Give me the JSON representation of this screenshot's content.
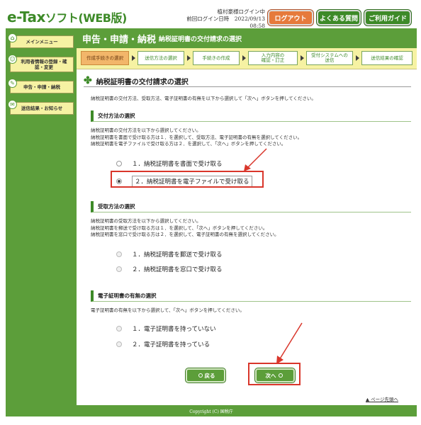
{
  "header": {
    "logo_main": "e-Tax",
    "logo_sub": "ソフト(WEB版)",
    "login_user": "植村豪様ログイン中",
    "last_login": "前回ログイン日時　2022/09/13 08:58",
    "logout_label": "ログアウト",
    "faq_label": "よくある質問",
    "guide_label": "ご利用ガイド"
  },
  "sidebar": {
    "items": [
      {
        "label": "メインメニュー",
        "icon": "home-icon"
      },
      {
        "label": "利用者情報の登録・確認・変更",
        "icon": "user-icon"
      },
      {
        "label": "申告・申請・納税",
        "icon": "document-icon"
      },
      {
        "label": "送信結果・お知らせ",
        "icon": "mail-icon"
      }
    ]
  },
  "main": {
    "title_big": "申告・申請・納税",
    "title_small": "納税証明書の交付請求の選択",
    "steps": [
      {
        "label": "作成手続きの選択",
        "active": true
      },
      {
        "label": "送信方法の選択",
        "active": false
      },
      {
        "label": "手続きの作成",
        "active": false
      },
      {
        "label": "入力内容の\n確認・訂正",
        "active": false
      },
      {
        "label": "受付システムへの\n送信",
        "active": false
      },
      {
        "label": "送信結果の確認",
        "active": false
      }
    ],
    "section_title": "納税証明書の交付請求の選択",
    "intro": "納税証明書の交付方法、受取方法、電子証明書の有無を以下から選択して「次へ」ボタンを押してください。",
    "delivery": {
      "heading": "交付方法の選択",
      "desc1": "納税証明書の交付方法を以下から選択してください。",
      "desc2": "納税証明書を書面で受け取る方は１．を選択して、受取方法、電子証明書の有無を選択してください。",
      "desc3": "納税証明書を電子ファイルで受け取る方は２．を選択して、「次へ」ボタンを押してください。",
      "options": [
        "１．納税証明書を書面で受け取る",
        "２．納税証明書を電子ファイルで受け取る"
      ],
      "selected_index": 1
    },
    "receive": {
      "heading": "受取方法の選択",
      "desc1": "納税証明書の受取方法を以下から選択してください。",
      "desc2": "納税証明書を郵送で受け取る方は１．を選択して、「次へ」ボタンを押してください。",
      "desc3": "納税証明書を窓口で受け取る方は２．を選択して、電子証明書の有無を選択してください。",
      "options": [
        "１．納税証明書を郵送で受け取る",
        "２．納税証明書を窓口で受け取る"
      ]
    },
    "cert": {
      "heading": "電子証明書の有無の選択",
      "desc1": "電子証明書の有無を以下から選択して、「次へ」ボタンを押してください。",
      "options": [
        "１．電子証明書を持っていない",
        "２．電子証明書を持っている"
      ]
    },
    "back_label": "戻る",
    "next_label": "次へ",
    "page_top": "ページ先頭へ",
    "copyright": "Copyright (C) 国税庁"
  },
  "colors": {
    "brand_green": "#5c9e3a",
    "highlight_red": "#d9362b",
    "step_active": "#f2b66a",
    "sidebar_item": "#f6f2a3"
  }
}
